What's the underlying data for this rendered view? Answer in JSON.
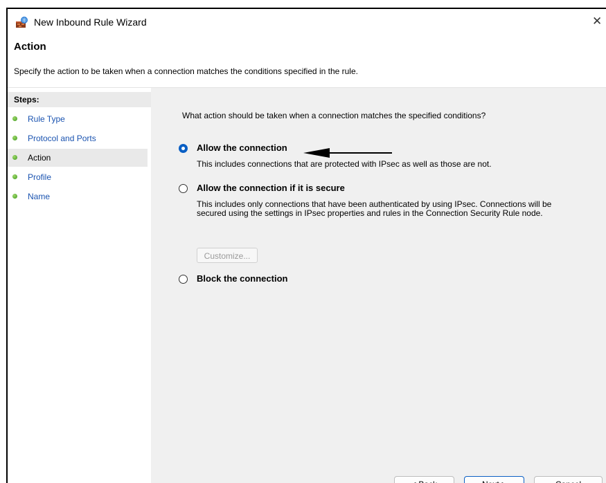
{
  "window": {
    "title": "New Inbound Rule Wizard",
    "close_glyph": "✕",
    "icon": "firewall-wizard-icon"
  },
  "header": {
    "title": "Action",
    "description": "Specify the action to be taken when a connection matches the conditions specified in the rule."
  },
  "steps": {
    "heading": "Steps:",
    "items": [
      {
        "label": "Rule Type",
        "current": false
      },
      {
        "label": "Protocol and Ports",
        "current": false
      },
      {
        "label": "Action",
        "current": true
      },
      {
        "label": "Profile",
        "current": false
      },
      {
        "label": "Name",
        "current": false
      }
    ]
  },
  "main": {
    "question": "What action should be taken when a connection matches the specified conditions?",
    "options": [
      {
        "label": "Allow the connection",
        "description": "This includes connections that are protected with IPsec as well as those are not.",
        "selected": true
      },
      {
        "label": "Allow the connection if it is secure",
        "description": "This includes only connections that have been authenticated by using IPsec.  Connections will be secured using the settings in IPsec properties and rules in the Connection Security Rule node.",
        "selected": false
      },
      {
        "label": "Block the connection",
        "description": "",
        "selected": false
      }
    ],
    "customize_label": "Customize..."
  },
  "buttons": {
    "back": "< Back",
    "next": "Next >",
    "cancel": "Cancel"
  },
  "colors": {
    "accent": "#0a5fc4",
    "step_link": "#1a53b0",
    "step_dot": "#3f9b1f",
    "pane_bg": "#f0f0f0"
  }
}
